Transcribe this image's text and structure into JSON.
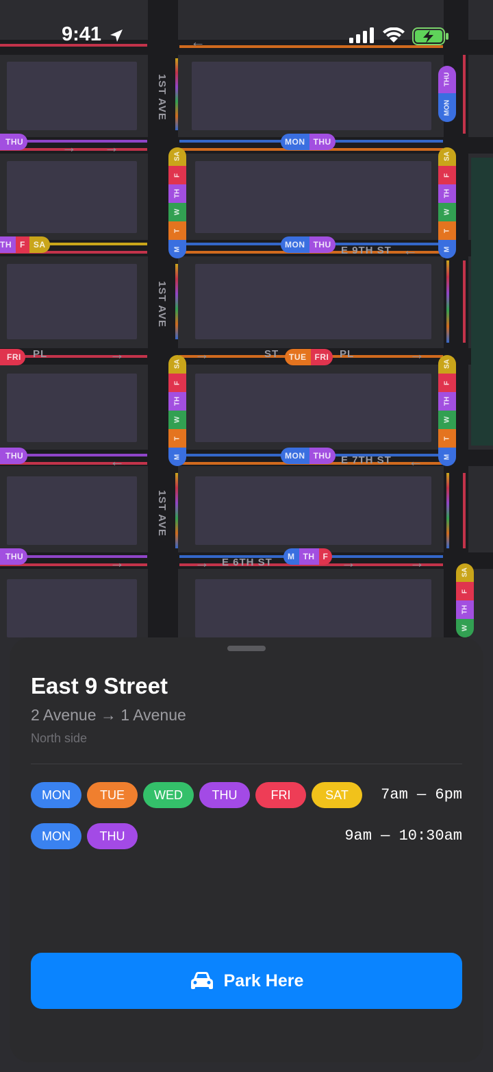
{
  "status_bar": {
    "time": "9:41",
    "icons": [
      "location-arrow-icon",
      "signal-icon",
      "wifi-icon",
      "battery-charging-icon"
    ]
  },
  "map": {
    "avenue_labels": [
      "1ST AVE",
      "1ST AVE",
      "1ST AVE"
    ],
    "street_labels": [
      "E 9TH ST",
      "ST",
      "PL",
      "PL",
      "E 7TH ST",
      "E 6TH ST"
    ],
    "pill_days": {
      "mon": "MON",
      "thu": "THU",
      "tue": "TUE",
      "fri": "FRI",
      "th": "TH",
      "f": "F",
      "sa": "SA",
      "m": "M",
      "t": "T",
      "w": "W"
    },
    "colors": {
      "mon": "#3a6fe0",
      "tue": "#e4741f",
      "wed": "#32b55a",
      "thu": "#a24fe0",
      "fri": "#e0344e",
      "sat": "#e3b818"
    }
  },
  "sheet": {
    "title": "East 9 Street",
    "route": "2 Avenue → 1 Avenue",
    "side": "North side",
    "schedules": [
      {
        "days": [
          {
            "label": "MON",
            "color": "#3a82f0"
          },
          {
            "label": "TUE",
            "color": "#f07f2e"
          },
          {
            "label": "WED",
            "color": "#34c06a"
          },
          {
            "label": "THU",
            "color": "#a34ae6"
          },
          {
            "label": "FRI",
            "color": "#ee3d56"
          },
          {
            "label": "SAT",
            "color": "#f1c21b"
          }
        ],
        "hours": "7am — 6pm"
      },
      {
        "days": [
          {
            "label": "MON",
            "color": "#3a82f0"
          },
          {
            "label": "THU",
            "color": "#a34ae6"
          }
        ],
        "hours": "9am — 10:30am"
      }
    ],
    "button": {
      "label": "Park Here",
      "icon": "car-icon",
      "color": "#0a84ff"
    }
  }
}
